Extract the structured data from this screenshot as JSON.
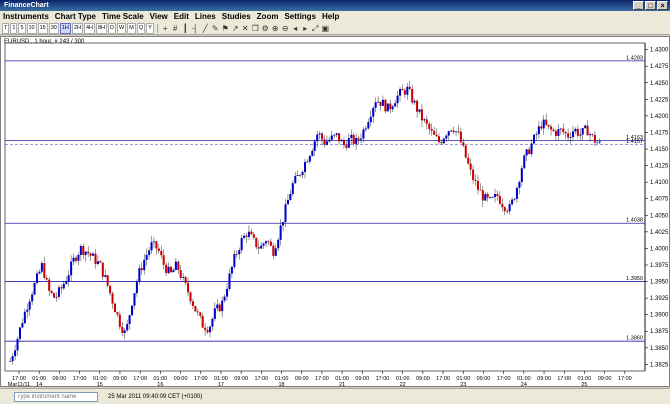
{
  "window": {
    "title": "FinanceChart",
    "btns": [
      "_",
      "□",
      "×"
    ]
  },
  "menu": [
    "Instruments",
    "Chart Type",
    "Time Scale",
    "View",
    "Edit",
    "Lines",
    "Studies",
    "Zoom",
    "Settings",
    "Help"
  ],
  "toolbar": {
    "timeframes": [
      "T",
      "1",
      "5",
      "10",
      "15",
      "30",
      "1H",
      "2H",
      "4H",
      "8H",
      "D",
      "W",
      "M",
      "Q",
      "Y"
    ],
    "active": "1H",
    "icons": [
      "crosshair-icon",
      "grid-icon",
      "candles-icon",
      "bars-icon",
      "line-icon",
      "pen-icon",
      "flag-icon",
      "arrow-icon",
      "delete-icon",
      "copy-icon",
      "settings-icon",
      "zoom-in-icon",
      "zoom-out-icon",
      "scroll-left-icon",
      "scroll-right-icon",
      "fit-icon",
      "lock-icon"
    ]
  },
  "chart": {
    "instrument_label": "EURUSD , 1 hour, # 243 / 300"
  },
  "status": {
    "search_placeholder": "Type instrument name",
    "datetime": "25 Mar 2011 09:40:09  CET (+0100)"
  },
  "chart_data": {
    "type": "candlestick",
    "price_range": [
      1.3815,
      1.431
    ],
    "y_ticks": [
      "1.4300",
      "1.4275",
      "1.4250",
      "1.4225",
      "1.4200",
      "1.4175",
      "1.4150",
      "1.4125",
      "1.4100",
      "1.4075",
      "1.4050",
      "1.4025",
      "1.4000",
      "1.3975",
      "1.3950",
      "1.3925",
      "1.3900",
      "1.3875",
      "1.3850",
      "1.3825"
    ],
    "x_labels": [
      "17:00",
      "01:00",
      "09:00",
      "17:00",
      "01:00",
      "09:00",
      "17:00",
      "01:00",
      "09:00",
      "17:00",
      "01:00",
      "09:00",
      "17:00",
      "01:00",
      "09:00",
      "17:00",
      "01:00",
      "09:00",
      "17:00",
      "01:00",
      "09:00",
      "17:00",
      "01:00",
      "09:00",
      "17:00",
      "01:00",
      "09:00",
      "17:00",
      "01:00",
      "09:00",
      "17:00"
    ],
    "day_labels": [
      {
        "label": "Mar11/11",
        "slot": 0
      },
      {
        "label": "14",
        "slot": 1
      },
      {
        "label": "15",
        "slot": 4
      },
      {
        "label": "16",
        "slot": 7
      },
      {
        "label": "17",
        "slot": 10
      },
      {
        "label": "18",
        "slot": 13
      },
      {
        "label": "21",
        "slot": 16
      },
      {
        "label": "22",
        "slot": 19
      },
      {
        "label": "23",
        "slot": 22
      },
      {
        "label": "24",
        "slot": 25
      },
      {
        "label": "25",
        "slot": 28
      }
    ],
    "h_lines": [
      {
        "label": "1.4283",
        "value": 1.4283
      },
      {
        "label": "1.4163",
        "value": 1.4163
      },
      {
        "label": "1.4038",
        "value": 1.4038
      },
      {
        "label": "1.3950",
        "value": 1.395
      },
      {
        "label": "1.3860",
        "value": 1.386
      }
    ],
    "last_price": {
      "label": "1.4157",
      "value": 1.4157
    },
    "path": [
      1.383,
      1.386,
      1.3895,
      1.3925,
      1.395,
      1.3975,
      1.3935,
      1.3925,
      1.394,
      1.396,
      1.3985,
      1.4,
      1.3995,
      1.3985,
      1.3975,
      1.395,
      1.392,
      1.389,
      1.387,
      1.392,
      1.396,
      1.3985,
      1.4005,
      1.4,
      1.3975,
      1.396,
      1.3975,
      1.395,
      1.393,
      1.3905,
      1.3885,
      1.388,
      1.3905,
      1.3915,
      1.395,
      1.3985,
      1.401,
      1.4025,
      1.401,
      1.4,
      1.4015,
      1.3995,
      1.4025,
      1.406,
      1.4095,
      1.411,
      1.413,
      1.415,
      1.4175,
      1.416,
      1.4165,
      1.417,
      1.4155,
      1.4165,
      1.416,
      1.4175,
      1.42,
      1.4225,
      1.422,
      1.421,
      1.4225,
      1.4235,
      1.424,
      1.422,
      1.42,
      1.4185,
      1.417,
      1.416,
      1.4175,
      1.4185,
      1.417,
      1.414,
      1.411,
      1.409,
      1.4075,
      1.407,
      1.408,
      1.4065,
      1.406,
      1.409,
      1.413,
      1.415,
      1.417,
      1.419,
      1.418,
      1.4175,
      1.4178,
      1.417,
      1.418,
      1.4172,
      1.418,
      1.4165,
      1.4157
    ]
  }
}
